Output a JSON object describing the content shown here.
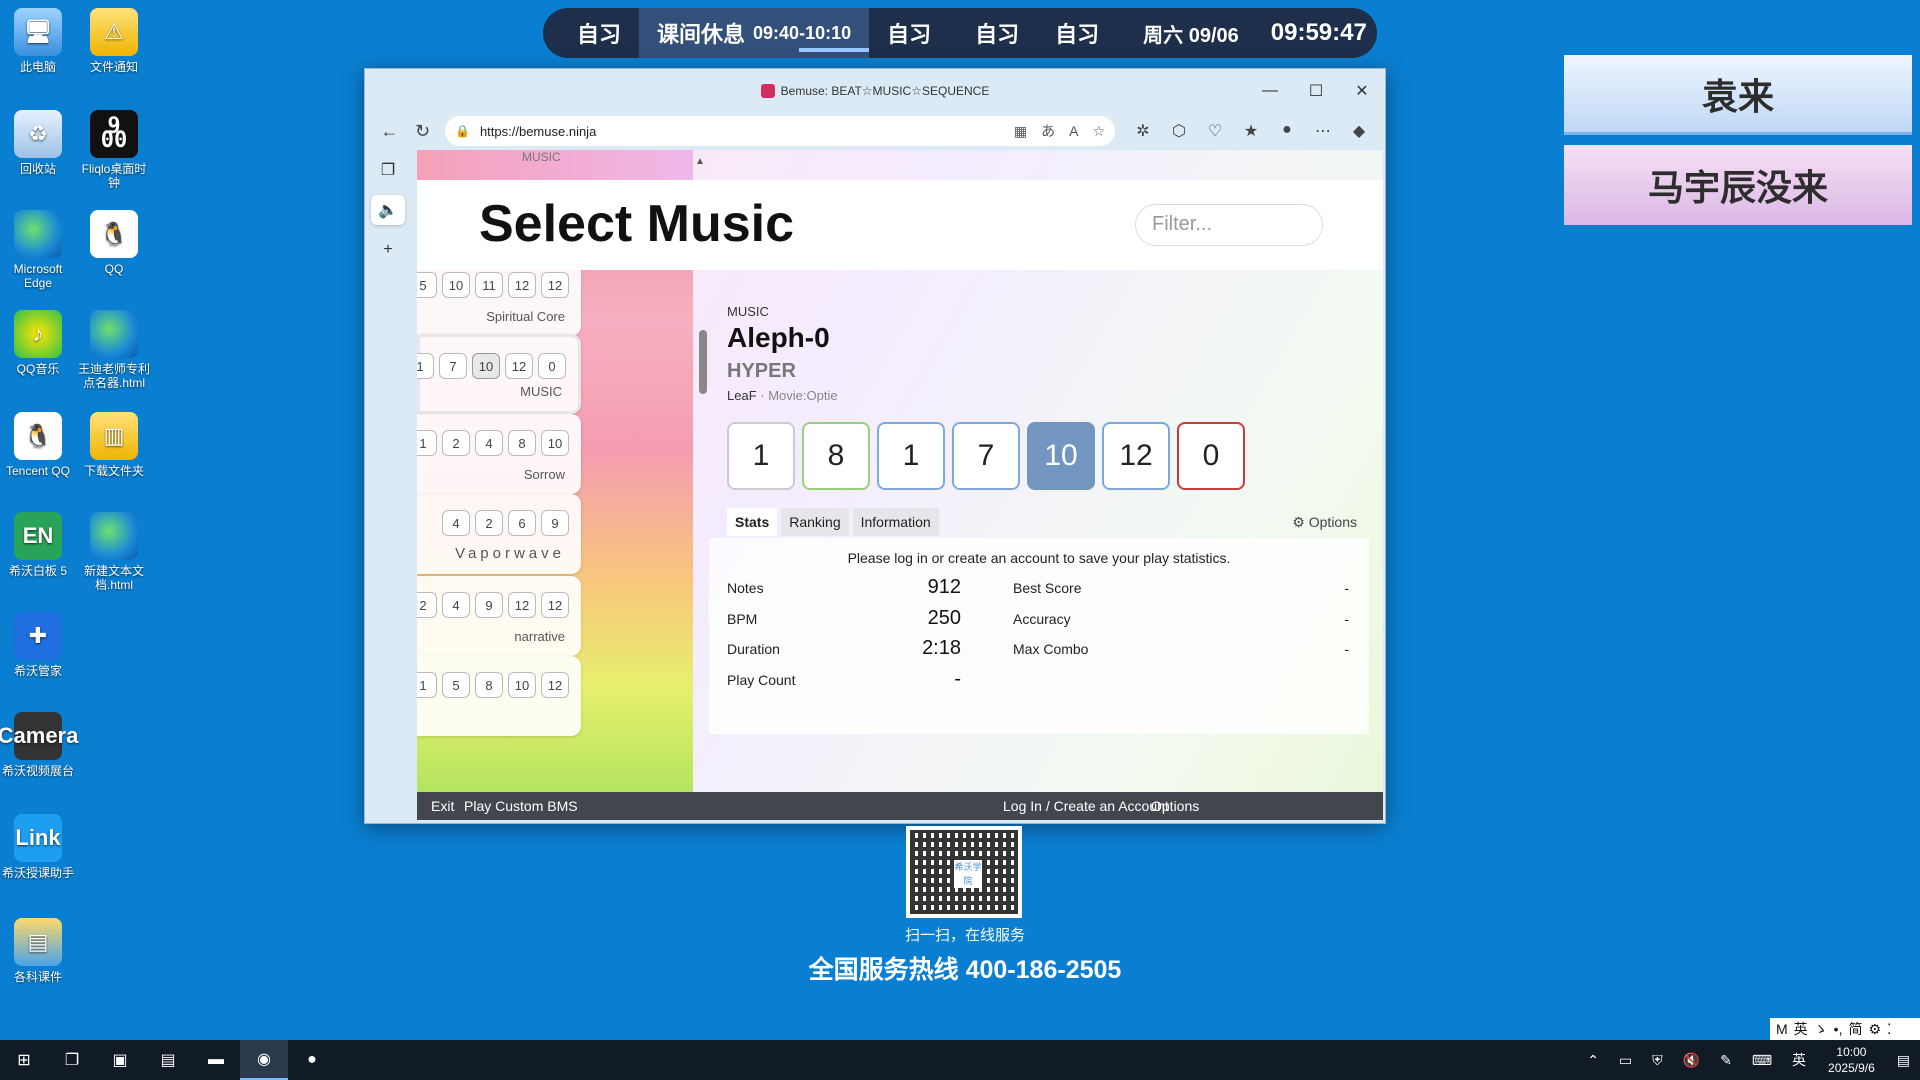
{
  "desktop": {
    "icons": [
      {
        "label": "此电脑",
        "glyph": "🖥"
      },
      {
        "label": "文件通知",
        "glyph": "⚠"
      },
      {
        "label": "回收站",
        "glyph": "♻"
      },
      {
        "label": "Fliqlo桌面时钟",
        "glyph": "9 00"
      },
      {
        "label": "Microsoft Edge",
        "glyph": ""
      },
      {
        "label": "QQ",
        "glyph": "🐧"
      },
      {
        "label": "QQ音乐",
        "glyph": "♪"
      },
      {
        "label": "王迪老师专利点名器.html",
        "glyph": ""
      },
      {
        "label": "Tencent QQ",
        "glyph": "🐧"
      },
      {
        "label": "下载文件夹",
        "glyph": "▥"
      },
      {
        "label": "希沃白板 5",
        "glyph": "EN"
      },
      {
        "label": "新建文本文档.html",
        "glyph": ""
      },
      {
        "label": "希沃管家",
        "glyph": "✚"
      },
      {
        "label": "希沃视频展台",
        "glyph": "Camera"
      },
      {
        "label": "希沃授课助手",
        "glyph": "Link"
      },
      {
        "label": "各科课件",
        "glyph": "▤"
      }
    ]
  },
  "schedule": {
    "item1": "自习",
    "active_label": "课间休息",
    "active_time": "09:40-10:10",
    "item3": "自习",
    "item4": "自习",
    "item5": "自习",
    "date": "周六 09/06",
    "clock": "09:59:47"
  },
  "cards": {
    "card1": "袁来",
    "card2": "马宇辰没来"
  },
  "browser": {
    "title": "Bemuse: BEAT☆MUSIC☆SEQUENCE",
    "url": "https://bemuse.ninja",
    "win_minimize": "—",
    "win_maximize": "☐",
    "win_close": "✕"
  },
  "page": {
    "heading": "Select Music",
    "filter_placeholder": "Filter...",
    "top_sliver_text": "MUSIC",
    "songs": [
      {
        "levels": [
          "5",
          "10",
          "11",
          "12",
          "12"
        ],
        "title": "Spiritual Core",
        "highlight": -1
      },
      {
        "levels": [
          "1",
          "7",
          "10",
          "12",
          "0"
        ],
        "title": "MUSIC",
        "highlight": 2
      },
      {
        "levels": [
          "1",
          "2",
          "4",
          "8",
          "10"
        ],
        "title": "Sorrow",
        "highlight": -1
      },
      {
        "levels": [
          "4",
          "2",
          "6",
          "9"
        ],
        "title": "Vaporwave",
        "highlight": -1
      },
      {
        "levels": [
          "2",
          "4",
          "9",
          "12",
          "12"
        ],
        "title": "narrative",
        "highlight": -1
      },
      {
        "levels": [
          "1",
          "5",
          "8",
          "10",
          "12"
        ],
        "title": "",
        "highlight": -1
      }
    ],
    "detail": {
      "genre": "MUSIC",
      "title": "Aleph-0",
      "subtitle": "HYPER",
      "artist": "LeaF",
      "movie": "· Movie:Optie",
      "difficulties": [
        "1",
        "8",
        "1",
        "7",
        "10",
        "12",
        "0"
      ],
      "tabs": [
        "Stats",
        "Ranking",
        "Information"
      ],
      "options_label": "Options",
      "notice": "Please log in or create an account to save your play statistics.",
      "stats_left": [
        {
          "label": "Notes",
          "value": "912"
        },
        {
          "label": "BPM",
          "value": "250"
        },
        {
          "label": "Duration",
          "value": "2:18"
        },
        {
          "label": "Play Count",
          "value": "-"
        }
      ],
      "stats_right": [
        {
          "label": "Best Score",
          "value": "-"
        },
        {
          "label": "Accuracy",
          "value": "-"
        },
        {
          "label": "Max Combo",
          "value": "-"
        }
      ]
    },
    "footer": {
      "exit": "Exit",
      "custom": "Play Custom BMS",
      "login": "Log In / Create an Account",
      "options": "Options"
    }
  },
  "qr": {
    "logo": "希沃学院",
    "caption": "扫一扫，在线服务",
    "hotline": "全国服务热线 400-186-2505"
  },
  "ime": {
    "items": [
      "M",
      "英",
      "ゝ",
      "•,",
      "简",
      "⚙",
      "⁚"
    ]
  },
  "taskbar": {
    "time": "10:00",
    "date": "2025/9/6",
    "tray_input": "英"
  },
  "colors": {
    "desktop_bg": "#0a7fd1",
    "schedule_bg": "#1d2f4a",
    "selected_difficulty": "#7396c0",
    "footer_bg": "#43474d"
  }
}
